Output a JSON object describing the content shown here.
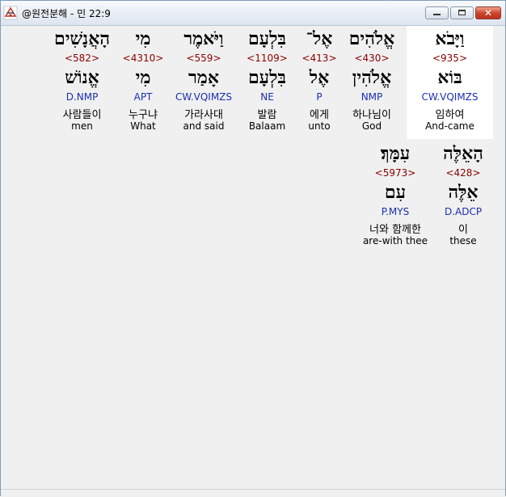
{
  "window": {
    "title": "@원전분해 - 민 22:9"
  },
  "words": [
    {
      "surface": "וַיָּבֹא",
      "strongs": "<935>",
      "lemma": "בּוֹא",
      "parse": "CW.VQIMZS",
      "korean": "임하여",
      "english": "And-came",
      "selected": true
    },
    {
      "surface": "אֱלֹהִים",
      "strongs": "<430>",
      "lemma": "אֱלֹהִין",
      "parse": "NMP",
      "korean": "하나님이",
      "english": "God",
      "selected": false
    },
    {
      "surface": "אֶל־",
      "strongs": "<413>",
      "lemma": "אֶל",
      "parse": "P",
      "korean": "에게",
      "english": "unto",
      "selected": false
    },
    {
      "surface": "בִּלְעָם",
      "strongs": "<1109>",
      "lemma": "בִּלְעָם",
      "parse": "NE",
      "korean": "발람",
      "english": "Balaam",
      "selected": false
    },
    {
      "surface": "וַיֹּאמֶר",
      "strongs": "<559>",
      "lemma": "אָמַר",
      "parse": "CW.VQIMZS",
      "korean": "가라사대",
      "english": "and said",
      "selected": false
    },
    {
      "surface": "מִי",
      "strongs": "<4310>",
      "lemma": "מִי",
      "parse": "APT",
      "korean": "누구냐",
      "english": "What",
      "selected": false
    },
    {
      "surface": "הָאֲנָשִׁים",
      "strongs": "<582>",
      "lemma": "אֱנוֹשׁ",
      "parse": "D.NMP",
      "korean": "사람들이",
      "english": "men",
      "selected": false
    },
    {
      "surface": "הָאֵלֶּה",
      "strongs": "<428>",
      "lemma": "אֵלֶּה",
      "parse": "D.ADCP",
      "korean": "이",
      "english": "these",
      "selected": false
    },
    {
      "surface": "עִמָּךְ׃",
      "strongs": "<5973>",
      "lemma": "עִם",
      "parse": "P.MYS",
      "korean": "너와 함께한",
      "english": "are-with thee",
      "selected": false
    }
  ]
}
